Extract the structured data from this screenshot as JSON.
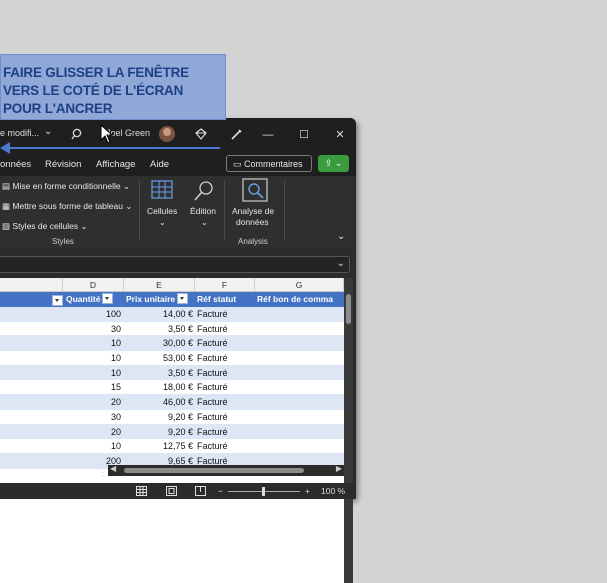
{
  "instruction": {
    "line1": "FAIRE GLISSER LA FENÊTRE",
    "line2": "VERS LE COTÉ DE L'ÉCRAN",
    "line3": "POUR L'ANCRER"
  },
  "titlebar": {
    "doc_status": "e modifi...",
    "user_name": "Joel Green",
    "minimize": "—",
    "maximize": "☐",
    "close": "✕"
  },
  "ribbon_tabs": [
    "onnées",
    "Révision",
    "Affichage",
    "Aide"
  ],
  "comments_label": "Commentaires",
  "ribbon": {
    "styles": {
      "conditional": "Mise en forme conditionnelle",
      "table": "Mettre sous forme de tableau",
      "cell_styles": "Styles de cellules",
      "label": "Styles"
    },
    "cells_label": "Cellules",
    "edition_label": "Édition",
    "analysis": {
      "button_line1": "Analyse de",
      "button_line2": "données",
      "label": "Analysis"
    }
  },
  "columns": [
    "D",
    "E",
    "F",
    "G"
  ],
  "table_headers": [
    "Quantité",
    "Prix unitaire",
    "Réf statut",
    "Réf bon de comma"
  ],
  "rows": [
    {
      "qty": "100",
      "price": "14,00 €",
      "status": "Facturé"
    },
    {
      "qty": "30",
      "price": "3,50 €",
      "status": "Facturé"
    },
    {
      "qty": "10",
      "price": "30,00 €",
      "status": "Facturé"
    },
    {
      "qty": "10",
      "price": "53,00 €",
      "status": "Facturé"
    },
    {
      "qty": "10",
      "price": "3,50 €",
      "status": "Facturé"
    },
    {
      "qty": "15",
      "price": "18,00 €",
      "status": "Facturé"
    },
    {
      "qty": "20",
      "price": "46,00 €",
      "status": "Facturé"
    },
    {
      "qty": "30",
      "price": "9,20 €",
      "status": "Facturé"
    },
    {
      "qty": "20",
      "price": "9,20 €",
      "status": "Facturé"
    },
    {
      "qty": "10",
      "price": "12,75 €",
      "status": "Facturé"
    },
    {
      "qty": "200",
      "price": "9,65 €",
      "status": "Facturé"
    }
  ],
  "status": {
    "zoom_minus": "−",
    "zoom_plus": "+",
    "zoom": "100 %"
  },
  "colors": {
    "accent_blue": "#4472c4",
    "share_green": "#3a9b3f",
    "tip_bg": "#8fa8d8",
    "tip_text": "#1d3f85"
  }
}
